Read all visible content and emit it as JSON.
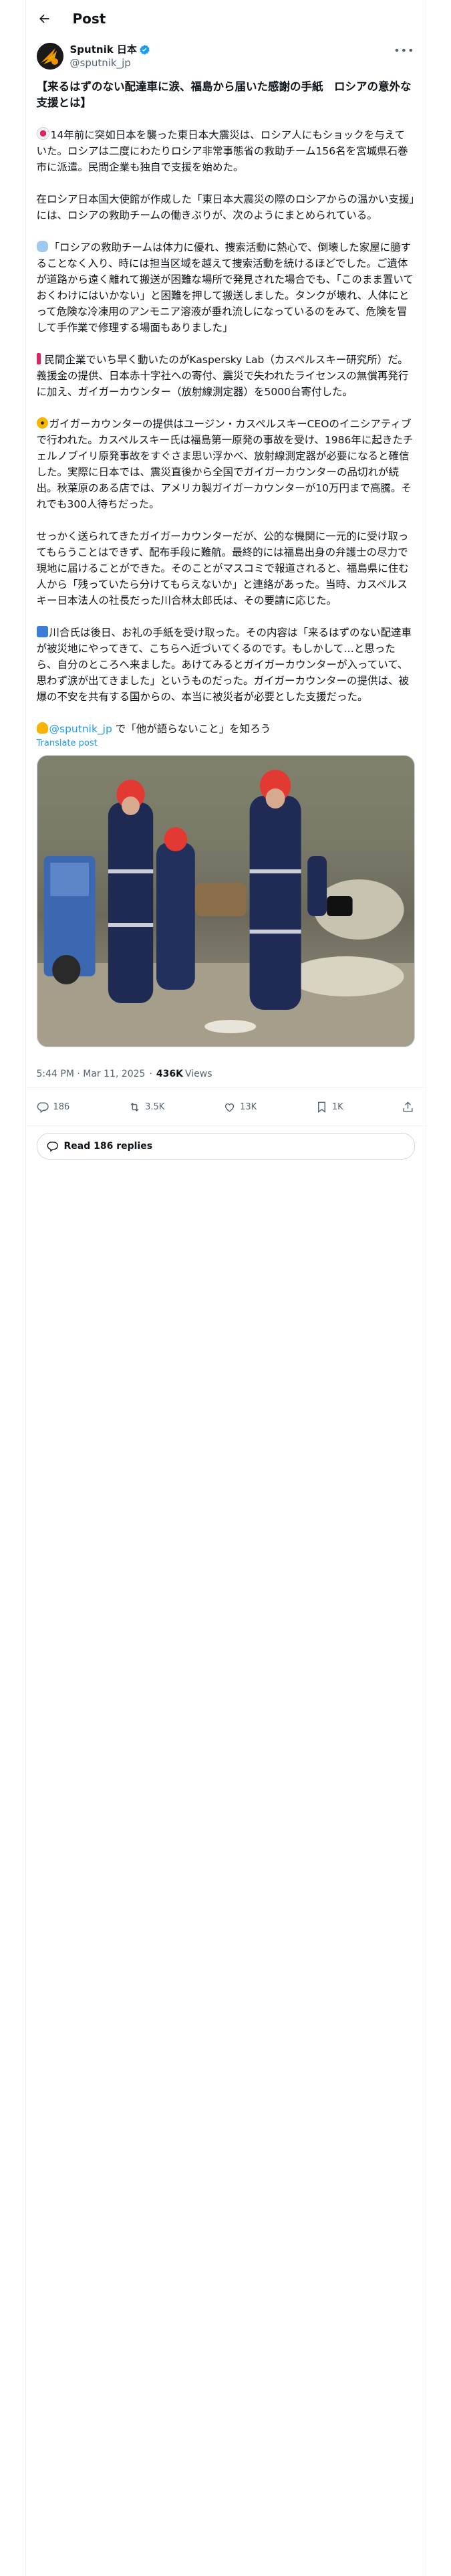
{
  "header": {
    "title": "Post"
  },
  "author": {
    "display_name": "Sputnik 日本",
    "handle": "@sputnik_jp"
  },
  "tweet": {
    "headline": "【来るはずのない配達車に涙、福島から届いた感謝の手紙　ロシアの意外な支援とは】",
    "p1": "14年前に突如日本を襲った東日本大震災は、ロシア人にもショックを与えていた。ロシアは二度にわたりロシア非常事態省の救助チーム156名を宮城県石巻市に派遣。民間企業も独自で支援を始めた。",
    "p2": "在ロシア日本国大使館が作成した「東日本大震災の際のロシアからの温かい支援」には、ロシアの救助チームの働きぶりが、次のようにまとめられている。",
    "p3": "「ロシアの救助チームは体力に優れ、捜索活動に熱心で、倒壊した家屋に臆することなく入り、時には担当区域を越えて捜索活動を続けるほどでした。ご遺体が道路から遠く離れて搬送が困難な場所で発見された場合でも、「このまま置いておくわけにはいかない」と困難を押して搬送しました。タンクが壊れ、人体にとって危険な冷凍用のアンモニア溶液が垂れ流しになっているのをみて、危険を冒して手作業で修理する場面もありました」",
    "p4": "民間企業でいち早く動いたのがKaspersky Lab（カスペルスキー研究所）だ。義援金の提供、日本赤十字社への寄付、震災で失われたライセンスの無償再発行に加え、ガイガーカウンター（放射線測定器）を5000台寄付した。",
    "p5": "ガイガーカウンターの提供はユージン・カスペルスキーCEOのイニシアティブで行われた。カスペルスキー氏は福島第一原発の事故を受け、1986年に起きたチェルノブイリ原発事故をすぐさま思い浮かべ、放射線測定器が必要になると確信した。実際に日本では、震災直後から全国でガイガーカウンターの品切れが続出。秋葉原のある店では、アメリカ製ガイガーカウンターが10万円まで高騰。それでも300人待ちだった。",
    "p6": "せっかく送られてきたガイガーカウンターだが、公的な機関に一元的に受け取ってもらうことはできず、配布手段に難航。最終的には福島出身の弁護士の尽力で現地に届けることができた。そのことがマスコミで報道されると、福島県に住む人から「残っていたら分けてもらえないか」と連絡があった。当時、カスペルスキー日本法人の社長だった川合林太郎氏は、その要請に応じた。",
    "p7": "川合氏は後日、お礼の手紙を受け取った。その内容は「来るはずのない配達車が被災地にやってきて、こちらへ近づいてくるのです。もしかして…と思ったら、自分のところへ来ました。あけてみるとガイガーカウンターが入っていて、思わず涙が出てきました」というものだった。ガイガーカウンターの提供は、被爆の不安を共有する国からの、本当に被災者が必要とした支援だった。",
    "footer_mention": "@sputnik_jp",
    "footer_text": "で「他が語らないこと」を知ろう"
  },
  "translate_label": "Translate post",
  "photo_icon": "rescue-workers-photo",
  "meta": {
    "time": "5:44 PM · Mar 11, 2025",
    "views_count": "436K",
    "views_label": "Views"
  },
  "actions": {
    "replies": "186",
    "reposts": "3.5K",
    "likes": "13K",
    "bookmarks": "1K"
  },
  "read_replies_label": "Read 186 replies",
  "colors": {
    "accent": "#1d9bf0",
    "text": "#0f1419",
    "muted": "#536471"
  }
}
